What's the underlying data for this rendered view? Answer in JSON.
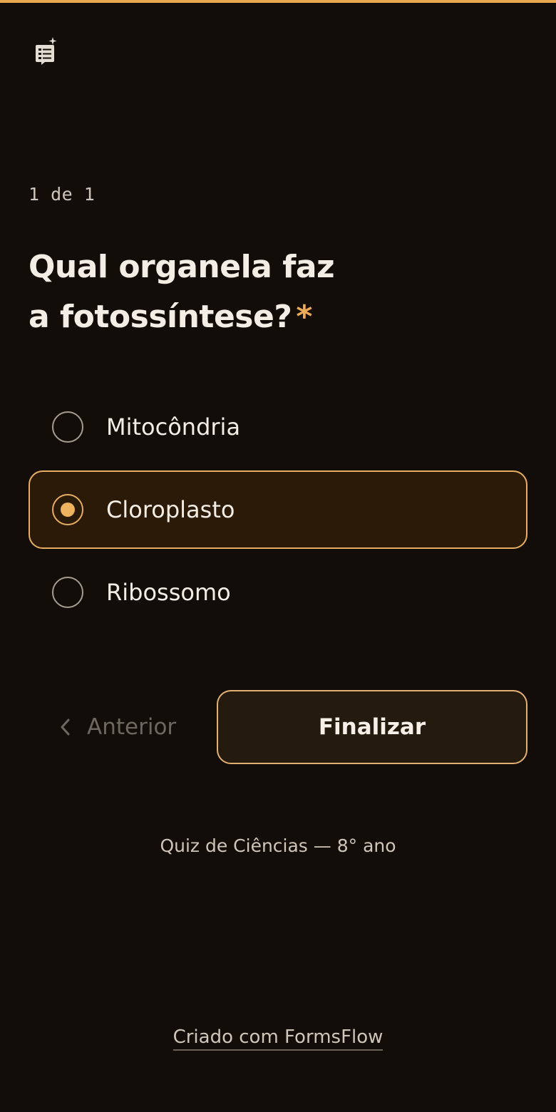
{
  "progress": "1 de 1",
  "question": {
    "text": "Qual organela faz a fotossíntese?",
    "required_mark": "*"
  },
  "options": [
    {
      "label": "Mitocôndria",
      "selected": false
    },
    {
      "label": "Cloroplasto",
      "selected": true
    },
    {
      "label": "Ribossomo",
      "selected": false
    }
  ],
  "navigation": {
    "prev_label": "Anterior",
    "finish_label": "Finalizar"
  },
  "form_title": "Quiz de Ciências — 8° ano",
  "footer": {
    "link_text": "Criado com FormsFlow"
  },
  "colors": {
    "accent": "#e7ad61",
    "background": "#120d09"
  },
  "icons": {
    "logo": "form-checklist-icon",
    "prev": "chevron-left-icon"
  }
}
